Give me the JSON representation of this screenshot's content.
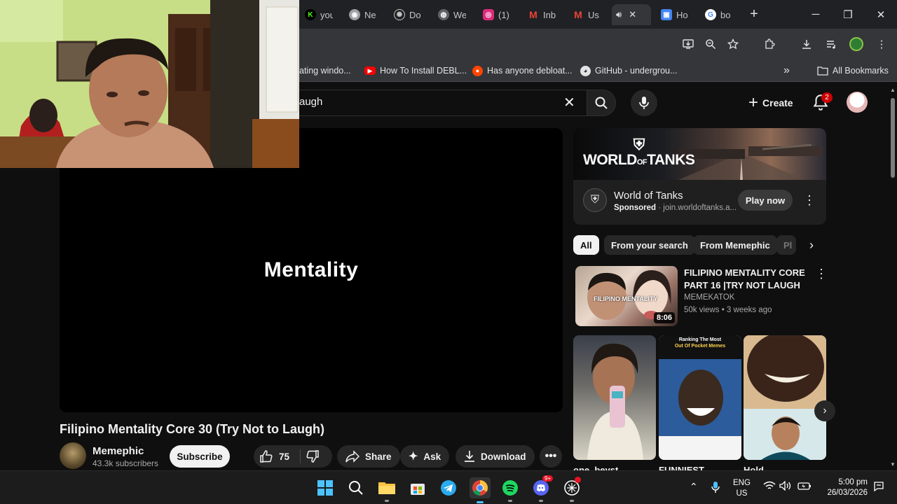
{
  "browser": {
    "tabs": [
      {
        "label": "you",
        "icon": "kick-icon",
        "color": "#53fc18"
      },
      {
        "label": "Ne",
        "icon": "chrome-icon",
        "color": "#9aa0a6"
      },
      {
        "label": "Do",
        "icon": "openai-icon",
        "color": "#9aa0a6"
      },
      {
        "label": "We",
        "icon": "globe-icon",
        "color": "#9aa0a6"
      },
      {
        "label": "(1)",
        "icon": "instagram-icon",
        "color": "#dd2a7b"
      },
      {
        "label": "Inb",
        "icon": "gmail-icon",
        "color": "#ea4335"
      },
      {
        "label": "Us",
        "icon": "gmail-icon",
        "color": "#ea4335"
      },
      {
        "label": "",
        "icon": "speaker-icon",
        "color": "#e3e3e3"
      },
      {
        "label": "Ho",
        "icon": "doc-icon",
        "color": "#4285f4"
      },
      {
        "label": "bo",
        "icon": "google-icon",
        "color": "#4285f4"
      }
    ],
    "new_tab": "+",
    "window": {
      "minimize": "─",
      "maximize": "❐",
      "close": "✕"
    }
  },
  "bookmarks": {
    "items": [
      {
        "label": "ating windo...",
        "icon": ""
      },
      {
        "label": "How To Install DEBL...",
        "icon": "youtube-icon"
      },
      {
        "label": "Has anyone debloat...",
        "icon": "reddit-icon"
      },
      {
        "label": "GitHub - undergrou...",
        "icon": "github-icon"
      }
    ],
    "overflow": "»",
    "all_bookmarks": "All Bookmarks"
  },
  "youtube": {
    "search_value": "augh",
    "create_label": "Create",
    "notifications_count": "2",
    "video": {
      "overlay_text": "Mentality",
      "title": "Filipino Mentality Core 30 (Try Not to Laugh)",
      "channel": "Memephic",
      "subscribers": "43.3k subscribers",
      "subscribe_label": "Subscribe",
      "likes": "75",
      "share_label": "Share",
      "ask_label": "Ask",
      "download_label": "Download"
    },
    "ad": {
      "logo_line1": "WORLD",
      "logo_of": "OF",
      "logo_line2": "TANKS",
      "title": "World of Tanks",
      "sponsored": "Sponsored",
      "domain": "join.worldoftanks.a...",
      "cta": "Play now"
    },
    "chips": [
      "All",
      "From your search",
      "From Memephic",
      "Pl"
    ],
    "recommended": {
      "title": "FILIPINO MENTALITY CORE PART 16 |TRY NOT LAUGH",
      "channel": "MEMEKATOK",
      "views": "50k views",
      "age": "3 weeks ago",
      "duration": "8:06",
      "thumb_text": "FILIPINO MENTALITY"
    },
    "shorts": [
      {
        "title": "one_beyst"
      },
      {
        "title": "FUNNIEST",
        "thumb_top": "Ranking The Most",
        "thumb_sub": "Out Of Pocket Memes"
      },
      {
        "title": "Hold"
      }
    ]
  },
  "taskbar": {
    "apps": [
      "windows-start-icon",
      "search-icon",
      "file-explorer-icon",
      "store-icon",
      "telegram-icon",
      "chrome-icon",
      "spotify-icon",
      "discord-icon",
      "chatgpt-icon"
    ],
    "discord_badge": "9+",
    "lang_line1": "ENG",
    "lang_line2": "US",
    "time": "5:00 pm",
    "date": "26/03/2026"
  }
}
